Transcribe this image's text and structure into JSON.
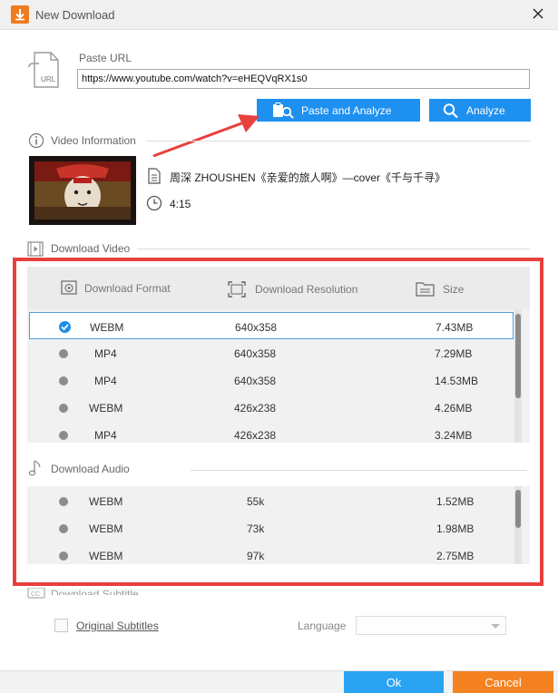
{
  "window": {
    "title": "New Download"
  },
  "paste_url": {
    "label": "Paste URL",
    "value": "https://www.youtube.com/watch?v=eHEQVqRX1s0",
    "url_icon_text": "URL"
  },
  "buttons": {
    "paste_and_analyze": "Paste and Analyze",
    "analyze": "Analyze",
    "ok": "Ok",
    "cancel": "Cancel"
  },
  "video_info": {
    "section_label": "Video Information",
    "title": "周深 ZHOUSHEN《亲爱的旅人啊》—cover《千与千寻》",
    "duration": "4:15"
  },
  "download_video": {
    "section_label": "Download Video",
    "columns": [
      "Download Format",
      "Download Resolution",
      "Size"
    ],
    "rows": [
      {
        "format": "WEBM",
        "resolution": "640x358",
        "size": "7.43MB",
        "selected": true
      },
      {
        "format": "MP4",
        "resolution": "640x358",
        "size": "7.29MB",
        "selected": false
      },
      {
        "format": "MP4",
        "resolution": "640x358",
        "size": "14.53MB",
        "selected": false
      },
      {
        "format": "WEBM",
        "resolution": "426x238",
        "size": "4.26MB",
        "selected": false
      },
      {
        "format": "MP4",
        "resolution": "426x238",
        "size": "3.24MB",
        "selected": false
      }
    ]
  },
  "download_audio": {
    "section_label": "Download Audio",
    "rows": [
      {
        "format": "WEBM",
        "bitrate": "55k",
        "size": "1.52MB"
      },
      {
        "format": "WEBM",
        "bitrate": "73k",
        "size": "1.98MB"
      },
      {
        "format": "WEBM",
        "bitrate": "97k",
        "size": "2.75MB"
      }
    ]
  },
  "subtitle": {
    "section_label": "Download Subtitle",
    "original_subtitles": "Original Subtitles",
    "language_label": "Language",
    "language_value": ""
  },
  "colors": {
    "accent_blue": "#1e90f0",
    "highlight_red": "#e8403e",
    "cancel_orange": "#f58220",
    "app_icon_orange": "#f07b1f"
  }
}
